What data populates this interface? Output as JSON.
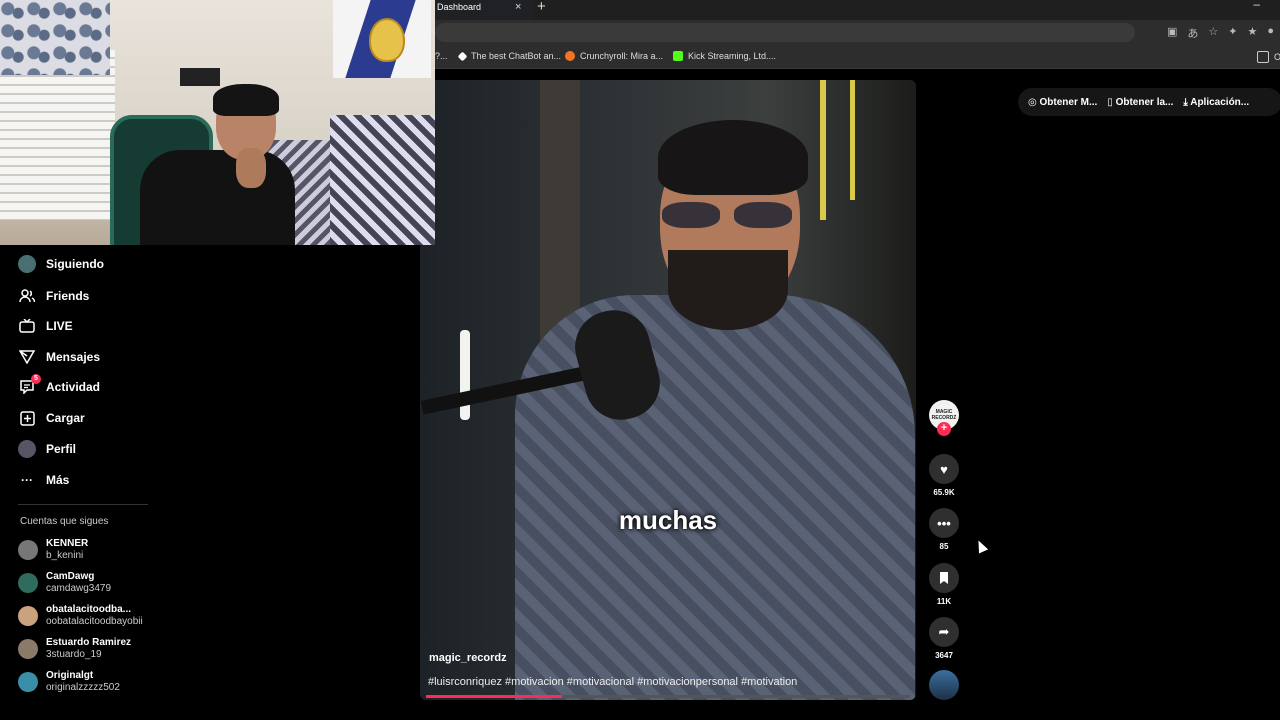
{
  "browser": {
    "tab_title": "Dashboard",
    "tab_close": "×",
    "new_tab": "+",
    "minimize": "–",
    "bookmarks": [
      {
        "label": "?..."
      },
      {
        "label": "The best ChatBot an..."
      },
      {
        "label": "Crunchyroll: Mira a..."
      },
      {
        "label": "Kick Streaming, Ltd...."
      },
      {
        "label": "O"
      }
    ]
  },
  "sidebar": {
    "items": [
      {
        "label": "Siguiendo",
        "icon": "avatar-icon"
      },
      {
        "label": "Friends",
        "icon": "friends-icon"
      },
      {
        "label": "LIVE",
        "icon": "live-icon"
      },
      {
        "label": "Mensajes",
        "icon": "send-icon"
      },
      {
        "label": "Actividad",
        "icon": "activity-icon",
        "badge": "5"
      },
      {
        "label": "Cargar",
        "icon": "upload-icon"
      },
      {
        "label": "Perfil",
        "icon": "profile-icon"
      },
      {
        "label": "Más",
        "icon": "more-icon"
      }
    ],
    "following_title": "Cuentas que sigues",
    "following": [
      {
        "name": "KENNER",
        "username": "b_kenini"
      },
      {
        "name": "CamDawg",
        "username": "camdawg3479"
      },
      {
        "name": "obatalacitoodba...",
        "username": "oobatalacitoodbayobii"
      },
      {
        "name": "Estuardo Ramirez",
        "username": "3stuardo_19"
      },
      {
        "name": "Originalgt",
        "username": "originalzzzzz502"
      }
    ]
  },
  "video": {
    "caption": "muchas",
    "username": "magic_recordz",
    "hashtags": "#luisrconriquez #motivacion #motivacional #motivacionpersonal #motivation",
    "progress": 0.28
  },
  "actions": {
    "author_logo": "MAGIC RECORDZ",
    "follow": "+",
    "likes": "65.9K",
    "comments": "85",
    "saves": "11K",
    "shares": "3647"
  },
  "get_app": {
    "items": [
      "Obtener M...",
      "Obtener la...",
      "Aplicación..."
    ]
  },
  "colors": {
    "accent": "#fe2c55",
    "bg": "#000000"
  }
}
